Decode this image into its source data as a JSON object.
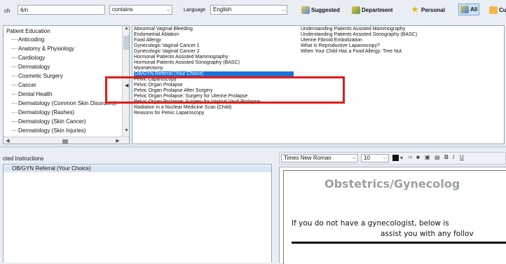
{
  "search": {
    "label": "ch",
    "value": "6/n"
  },
  "filter_select": {
    "value": "contains"
  },
  "language": {
    "label": "Language",
    "value": "English"
  },
  "toolbar": {
    "suggested": "Suggested",
    "department": "Department",
    "personal": "Personal",
    "all": "All",
    "cut": "Cu"
  },
  "tree": {
    "root": "Patient Education",
    "items": [
      "Anticoding",
      "Anatomy & Physiology",
      "Cardiology",
      "Dermatology",
      "Cosmetic Surgery",
      "Cancer",
      "Dental Health",
      "Dermatology (Common Skin Disorders)",
      "Dermatology (Rashes)",
      "Dermatology (Skin Cancer)",
      "Dermatology (Skin Injuries)"
    ]
  },
  "education_list": {
    "items": [
      "Abnormal Vaginal Bleeding",
      "Endometrial Ablation",
      "Food Allergy",
      "Gynecologic Vaginal Cancer 1",
      "Gynecologic Vaginal Cancer 2",
      "Hormonal Patients Assisted Mammography",
      "Hormonal Patients Assisted Sonography (BASC)",
      "Myomectomy",
      "OB/GYN Referral (Your Choice)",
      "Pelvic Laparoscopy",
      "Pelvic Organ Prolapse",
      "Pelvic Organ Prolapse After Surgery",
      "Pelvic Organ Prolapse: Surgery for Uterine Prolapse",
      "Pelvic Organ Prolapse: Surgery for Vaginal Vault Prolapse",
      "Radiation in a Nuclear Medicine Scan (Child)",
      "Reasons for Pelvic Laparoscopy"
    ],
    "selected_index": 8
  },
  "education_list_2": {
    "items": [
      "Understanding Patients Assisted Mammography",
      "Understanding Patients Assisted Sonography (BASC)",
      "Uterine Fibroid Embolization",
      "What Is Reproductive Laparoscopy?",
      "When Your Child Has a Food Allergy: Tree Nut"
    ]
  },
  "instructions": {
    "header": "cted Instructions",
    "items": [
      "OB/GYN Referral (Your Choice)"
    ]
  },
  "editor": {
    "font": "Times New Roman",
    "size": "10",
    "heading": "Obstetrics/Gynecolog",
    "body_line1": "If you do not have a gynecologist, below is",
    "body_line2": "assist you with any follov"
  },
  "colors": {
    "background": "#e9eef5",
    "selection": "#1a73d9",
    "highlight_box": "#e01b1b",
    "heading_text": "#9aa0a6"
  }
}
